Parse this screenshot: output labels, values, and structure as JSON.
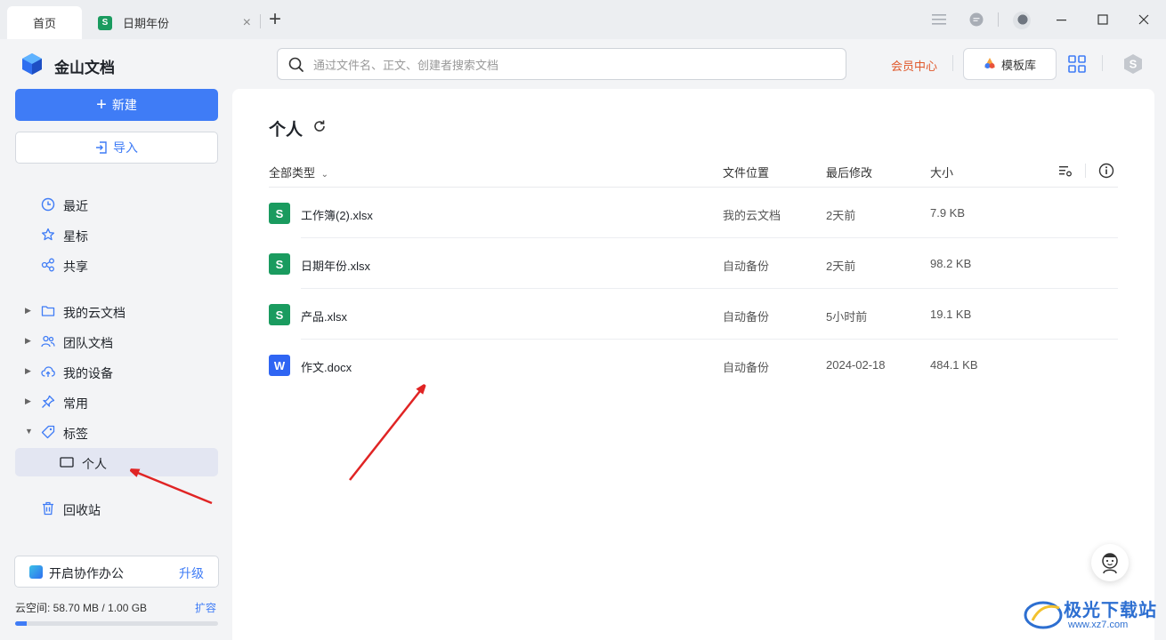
{
  "tabs": [
    {
      "label": "首页"
    },
    {
      "label": "日期年份"
    }
  ],
  "app": {
    "name": "金山文档"
  },
  "search": {
    "placeholder": "通过文件名、正文、创建者搜索文档"
  },
  "header": {
    "member": "会员中心",
    "template": "模板库"
  },
  "sidebar": {
    "new_label": "新建",
    "import_label": "导入",
    "items": [
      {
        "label": "最近"
      },
      {
        "label": "星标"
      },
      {
        "label": "共享"
      },
      {
        "label": "我的云文档"
      },
      {
        "label": "团队文档"
      },
      {
        "label": "我的设备"
      },
      {
        "label": "常用"
      },
      {
        "label": "标签"
      },
      {
        "label": "个人"
      },
      {
        "label": "回收站"
      }
    ],
    "collab_label": "开启协作办公",
    "upgrade_label": "升级",
    "storage_text": "云空间: 58.70 MB / 1.00 GB",
    "storage_used_fraction": 0.057,
    "expand_label": "扩容"
  },
  "main": {
    "title": "个人",
    "columns": {
      "type": "全部类型",
      "location": "文件位置",
      "modified": "最后修改",
      "size": "大小"
    },
    "files": [
      {
        "icon": "S",
        "kind": "xls",
        "name": "工作簿(2).xlsx",
        "location": "我的云文档",
        "modified": "2天前",
        "size": "7.9 KB"
      },
      {
        "icon": "S",
        "kind": "xls",
        "name": "日期年份.xlsx",
        "location": "自动备份",
        "modified": "2天前",
        "size": "98.2 KB"
      },
      {
        "icon": "S",
        "kind": "xls",
        "name": "产品.xlsx",
        "location": "自动备份",
        "modified": "5小时前",
        "size": "19.1 KB"
      },
      {
        "icon": "W",
        "kind": "doc",
        "name": "作文.docx",
        "location": "自动备份",
        "modified": "2024-02-18",
        "size": "484.1 KB"
      }
    ]
  },
  "watermark": {
    "text": "极光下载站",
    "url": "www.xz7.com"
  },
  "colors": {
    "accent": "#3f7cf6",
    "xls": "#1a9b5f",
    "doc": "#2f65f3",
    "annotation": "#e02424",
    "member": "#e0582a"
  }
}
